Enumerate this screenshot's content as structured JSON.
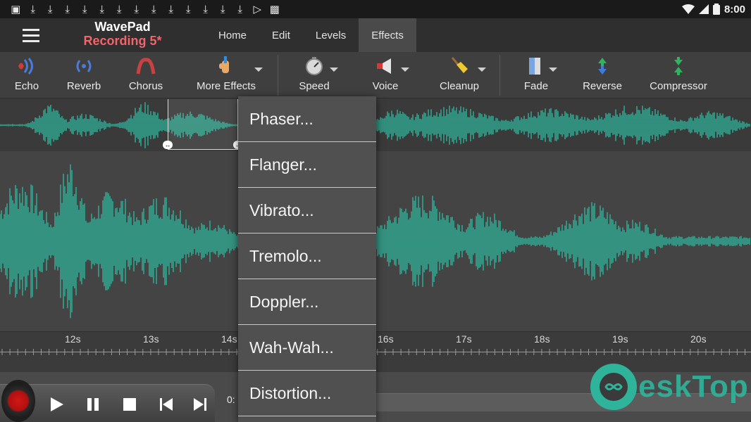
{
  "status_bar": {
    "time": "8:00",
    "notification_icons": [
      "image-icon",
      "download-icon",
      "download-icon",
      "download-icon",
      "download-icon",
      "download-icon",
      "download-icon",
      "download-icon",
      "download-icon",
      "download-icon",
      "download-icon",
      "download-icon",
      "download-icon",
      "download-icon",
      "play-store-icon",
      "app-icon"
    ]
  },
  "app_bar": {
    "app_name": "WavePad",
    "recording_name": "Recording 5*",
    "tabs": [
      {
        "label": "Home",
        "active": false
      },
      {
        "label": "Edit",
        "active": false
      },
      {
        "label": "Levels",
        "active": false
      },
      {
        "label": "Effects",
        "active": true
      }
    ]
  },
  "toolbar": {
    "tools": [
      {
        "label": "Echo",
        "icon": "echo-icon"
      },
      {
        "label": "Reverb",
        "icon": "reverb-icon"
      },
      {
        "label": "Chorus",
        "icon": "chorus-icon"
      },
      {
        "label": "More Effects",
        "icon": "more-effects-icon"
      },
      {
        "label": "Speed",
        "icon": "speed-icon"
      },
      {
        "label": "Voice",
        "icon": "voice-icon"
      },
      {
        "label": "Cleanup",
        "icon": "cleanup-icon"
      },
      {
        "label": "Fade",
        "icon": "fade-icon"
      },
      {
        "label": "Reverse",
        "icon": "reverse-icon"
      },
      {
        "label": "Compressor",
        "icon": "compressor-icon"
      }
    ]
  },
  "timeline": {
    "labels": [
      "12s",
      "13s",
      "14s",
      "16s",
      "17s",
      "18s",
      "19s",
      "20s"
    ]
  },
  "transport": {
    "time_readout": "0:"
  },
  "more_effects_menu": {
    "items": [
      "Phaser...",
      "Flanger...",
      "Vibrato...",
      "Tremolo...",
      "Doppler...",
      "Wah-Wah...",
      "Distortion..."
    ]
  },
  "watermark": {
    "text": "eskTop"
  },
  "colors": {
    "waveform": "#2fb39a",
    "recording_name": "#f2646a",
    "record_button": "#d01818"
  }
}
